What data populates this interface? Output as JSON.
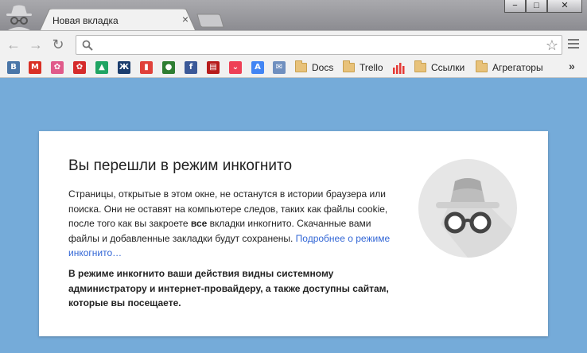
{
  "window": {
    "tab_title": "Новая вкладка",
    "tab_close": "×",
    "controls": {
      "minimize": "−",
      "maximize": "□",
      "close": "✕"
    }
  },
  "toolbar": {
    "back": "←",
    "forward": "→",
    "reload": "↻",
    "omnibox_value": "",
    "star": "☆"
  },
  "bookmarks": {
    "items": [
      {
        "label": "",
        "icon": "vk-icon",
        "glyph": "B",
        "color": "#4a76a8"
      },
      {
        "label": "",
        "icon": "gmail-icon",
        "glyph": "M",
        "color": "#d93025"
      },
      {
        "label": "",
        "icon": "flower-icon",
        "glyph": "✿",
        "color": "#e05a8a"
      },
      {
        "label": "",
        "icon": "flower-red-icon",
        "glyph": "✿",
        "color": "#d52b2b"
      },
      {
        "label": "",
        "icon": "google-drive-icon",
        "glyph": "▲",
        "color": "#1fa463"
      },
      {
        "label": "",
        "icon": "odnoklassniki-icon",
        "glyph": "Ж",
        "color": "#1b3d6d"
      },
      {
        "label": "",
        "icon": "trello-board-icon",
        "glyph": "▮",
        "color": "#e0413a"
      },
      {
        "label": "",
        "icon": "green-circle-icon",
        "glyph": "●",
        "color": "#2e7d32"
      },
      {
        "label": "",
        "icon": "facebook-icon",
        "glyph": "f",
        "color": "#3b5998"
      },
      {
        "label": "",
        "icon": "calendar-icon",
        "glyph": "▤",
        "color": "#b71c1c"
      },
      {
        "label": "",
        "icon": "pocket-icon",
        "glyph": "⌄",
        "color": "#ee4056"
      },
      {
        "label": "",
        "icon": "translate-icon",
        "glyph": "A",
        "color": "#4285f4"
      },
      {
        "label": "",
        "icon": "mail-icon",
        "glyph": "✉",
        "color": "#6f8fbf"
      }
    ],
    "folders": [
      {
        "label": "Docs"
      },
      {
        "label": "Trello"
      }
    ],
    "chart_icon": "bar-chart-icon",
    "folders2": [
      {
        "label": "Ссылки"
      },
      {
        "label": "Агрегаторы"
      }
    ],
    "more": "»"
  },
  "card": {
    "heading": "Вы перешли в режим инкогнито",
    "para_1": "Страницы, открытые в этом окне, не останутся в истории браузера или поиска. Они не оставят на компьютере следов, таких как файлы cookie, после того как вы закроете ",
    "para_bold": "все",
    "para_2": " вкладки инкогнито. Скачанные вами файлы и добавленные закладки будут сохранены. ",
    "learn_more": "Подробнее о режиме инкогнито…",
    "warning": "В режиме инкогнито ваши действия видны системному администратору и интернет-провайдеру, а также доступны сайтам, которые вы посещаете."
  },
  "colors": {
    "page_bg": "#75abd9",
    "link": "#3367d6"
  }
}
